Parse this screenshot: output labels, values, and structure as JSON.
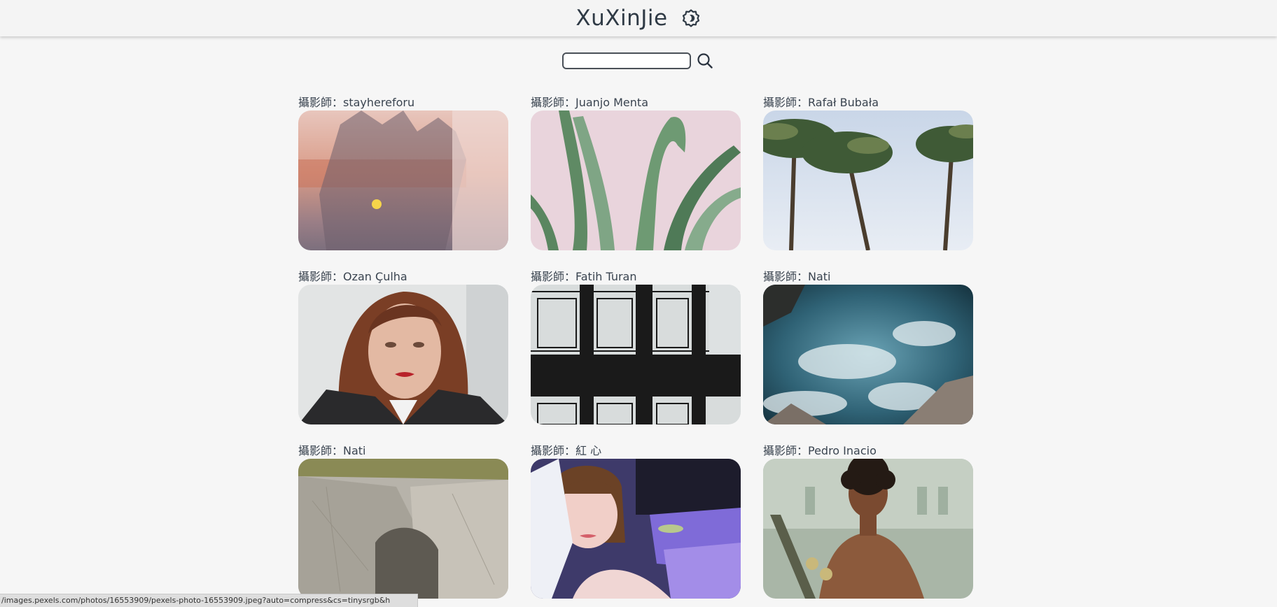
{
  "header": {
    "title": "XuXinJie",
    "settings_icon": "gear-icon"
  },
  "search": {
    "value": "",
    "placeholder": "",
    "icon": "search-icon"
  },
  "gallery": {
    "items": [
      {
        "caption": "攝影師：stayhereforu",
        "subject": "hand shadow sunset"
      },
      {
        "caption": "攝影師：Juanjo Menta",
        "subject": "agave leaves"
      },
      {
        "caption": "攝影師：Rafał Bubała",
        "subject": "palm trees"
      },
      {
        "caption": "攝影師：Ozan Çulha",
        "subject": "portrait woman"
      },
      {
        "caption": "攝影師：Fatih Turan",
        "subject": "scaffolding structure"
      },
      {
        "caption": "攝影師：Nati",
        "subject": "ocean waves rocks"
      },
      {
        "caption": "攝影師：Nati",
        "subject": "rock cliff"
      },
      {
        "caption": "攝影師：紅 心",
        "subject": "woman at table"
      },
      {
        "caption": "攝影師：Pedro Inacio",
        "subject": "man with skateboard"
      }
    ]
  },
  "status_bar": {
    "url": "/images.pexels.com/photos/16553909/pexels-photo-16553909.jpeg?auto=compress&cs=tinysrgb&h"
  }
}
